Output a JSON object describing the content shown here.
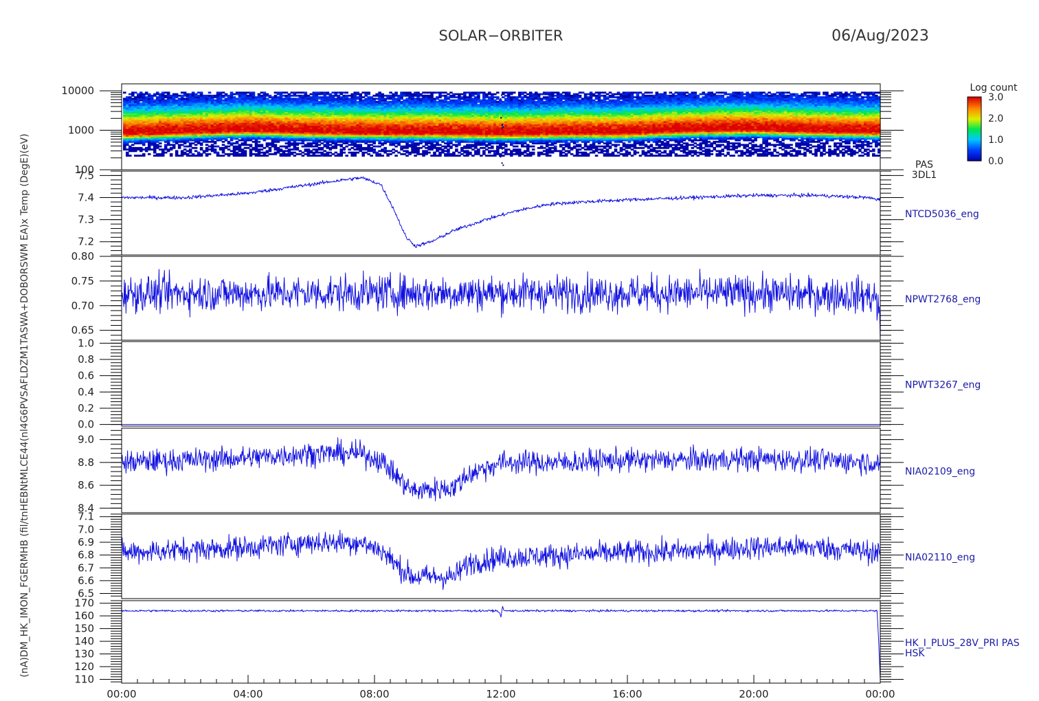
{
  "header": {
    "mission": "SOLAR−ORBITER",
    "date": "06/Aug/2023"
  },
  "colorbar": {
    "title": "Log count",
    "ticks": [
      "3.0",
      "2.0",
      "1.0",
      "0.0"
    ],
    "range": [
      0.0,
      3.0
    ]
  },
  "yaxis_overlap_label": "(nA)DM_HK_IMON_FGERMHB (fil/tnHEBNtMLCE44(nl4G6PVSAFLDZM1TASWA+DOBORSWM EA)x Temp (DegE)(eV)",
  "xaxis": {
    "ticks": [
      "00:00",
      "04:00",
      "08:00",
      "12:00",
      "16:00",
      "20:00",
      "00:00"
    ],
    "hours": [
      0,
      4,
      8,
      12,
      16,
      20,
      24
    ]
  },
  "colors": {
    "trace": "#1010e0",
    "label": "#1a1aa8",
    "axis": "#000000"
  },
  "chart_data": [
    {
      "type": "heatmap",
      "label": "PAS 3DL1",
      "label_lines": [
        "PAS",
        "3DL1"
      ],
      "ylabel": "(eV)",
      "yscale": "log",
      "ylim": [
        100,
        15000
      ],
      "yticks": [
        100,
        1000,
        10000
      ],
      "ytick_labels": [
        "100",
        "1000",
        "10000"
      ],
      "peak_energy_eV": [
        {
          "hour": 0,
          "value": 850
        },
        {
          "hour": 2,
          "value": 950
        },
        {
          "hour": 4,
          "value": 1050
        },
        {
          "hour": 6,
          "value": 950
        },
        {
          "hour": 8,
          "value": 900
        },
        {
          "hour": 10,
          "value": 900
        },
        {
          "hour": 12,
          "value": 850
        },
        {
          "hour": 14,
          "value": 900
        },
        {
          "hour": 16,
          "value": 900
        },
        {
          "hour": 18,
          "value": 1050
        },
        {
          "hour": 20,
          "value": 1100
        },
        {
          "hour": 22,
          "value": 1000
        },
        {
          "hour": 24,
          "value": 950
        }
      ]
    },
    {
      "type": "line",
      "label": "NTCD5036_eng",
      "ylabel": "Temp (DegC)",
      "ylim": [
        7.14,
        7.52
      ],
      "yticks": [
        7.2,
        7.3,
        7.4,
        7.5
      ],
      "ytick_labels": [
        "7.2",
        "7.3",
        "7.4",
        "7.5"
      ],
      "noise": 0.004,
      "x": [
        0,
        1,
        2,
        3,
        4,
        5,
        6,
        7,
        7.6,
        8.2,
        8.6,
        9.0,
        9.3,
        9.8,
        10.5,
        11.5,
        12.5,
        13.5,
        14.5,
        16,
        18,
        20,
        22,
        23.6,
        24
      ],
      "values": [
        7.4,
        7.4,
        7.4,
        7.41,
        7.42,
        7.44,
        7.46,
        7.48,
        7.49,
        7.46,
        7.35,
        7.22,
        7.18,
        7.2,
        7.25,
        7.3,
        7.34,
        7.37,
        7.38,
        7.39,
        7.4,
        7.41,
        7.41,
        7.4,
        7.39
      ]
    },
    {
      "type": "line",
      "label": "NPWT2768_eng",
      "ylabel": "",
      "ylim": [
        0.63,
        0.8
      ],
      "yticks": [
        0.65,
        0.7,
        0.75,
        0.8
      ],
      "ytick_labels": [
        "0.65",
        "0.70",
        "0.75",
        "0.80"
      ],
      "noise": 0.018,
      "x": [
        0,
        4,
        8,
        12,
        16,
        20,
        23.8,
        23.95,
        24
      ],
      "values": [
        0.725,
        0.725,
        0.726,
        0.726,
        0.725,
        0.725,
        0.72,
        0.7,
        0.63
      ]
    },
    {
      "type": "line",
      "label": "NPWT3267_eng",
      "ylabel": "",
      "ylim": [
        -0.02,
        1.02
      ],
      "yticks": [
        0.0,
        0.2,
        0.4,
        0.6,
        0.8,
        1.0
      ],
      "ytick_labels": [
        "0.0",
        "0.2",
        "0.4",
        "0.6",
        "0.8",
        "1.0"
      ],
      "noise": 0,
      "x": [
        0,
        24
      ],
      "values": [
        0.0,
        0.0
      ]
    },
    {
      "type": "line",
      "label": "NIA02109_eng",
      "ylabel": "",
      "ylim": [
        8.36,
        9.1
      ],
      "yticks": [
        8.4,
        8.6,
        8.8,
        9.0
      ],
      "ytick_labels": [
        "8.4",
        "8.6",
        "8.8",
        "9.0"
      ],
      "noise": 0.05,
      "x": [
        0,
        2,
        4,
        6,
        7.5,
        8.2,
        8.8,
        9.2,
        10.5,
        11,
        12,
        14,
        16,
        18,
        20,
        22,
        24
      ],
      "values": [
        8.8,
        8.82,
        8.84,
        8.88,
        8.88,
        8.82,
        8.65,
        8.55,
        8.58,
        8.7,
        8.8,
        8.8,
        8.82,
        8.82,
        8.83,
        8.82,
        8.8
      ]
    },
    {
      "type": "line",
      "label": "NIA02110_eng",
      "ylabel": "",
      "ylim": [
        6.46,
        7.12
      ],
      "yticks": [
        6.5,
        6.6,
        6.7,
        6.8,
        6.9,
        7.0,
        7.1
      ],
      "ytick_labels": [
        "6.5",
        "6.6",
        "6.7",
        "6.8",
        "6.9",
        "7.0",
        "7.1"
      ],
      "noise": 0.045,
      "x": [
        0,
        2,
        4,
        6,
        7.5,
        8.2,
        8.8,
        9.2,
        10.5,
        11,
        12,
        14,
        16,
        18,
        20,
        22,
        24
      ],
      "values": [
        6.82,
        6.84,
        6.86,
        6.9,
        6.9,
        6.84,
        6.7,
        6.63,
        6.63,
        6.74,
        6.78,
        6.8,
        6.82,
        6.83,
        6.86,
        6.86,
        6.82
      ]
    },
    {
      "type": "line",
      "label": "HK_I_PLUS_28V_PRI PAS HSK",
      "label_lines": [
        "HK_I_PLUS_28V_PRI PAS",
        "HSK"
      ],
      "ylabel": "(mA)",
      "ylim": [
        107,
        172
      ],
      "yticks": [
        110,
        120,
        130,
        140,
        150,
        160,
        170
      ],
      "ytick_labels": [
        "110",
        "120",
        "130",
        "140",
        "150",
        "160",
        "170"
      ],
      "noise": 0.4,
      "x": [
        0,
        11.9,
        12.0,
        12.05,
        12.1,
        23.9,
        23.95,
        24
      ],
      "values": [
        164,
        164,
        160,
        167,
        164,
        164,
        140,
        110
      ]
    }
  ]
}
